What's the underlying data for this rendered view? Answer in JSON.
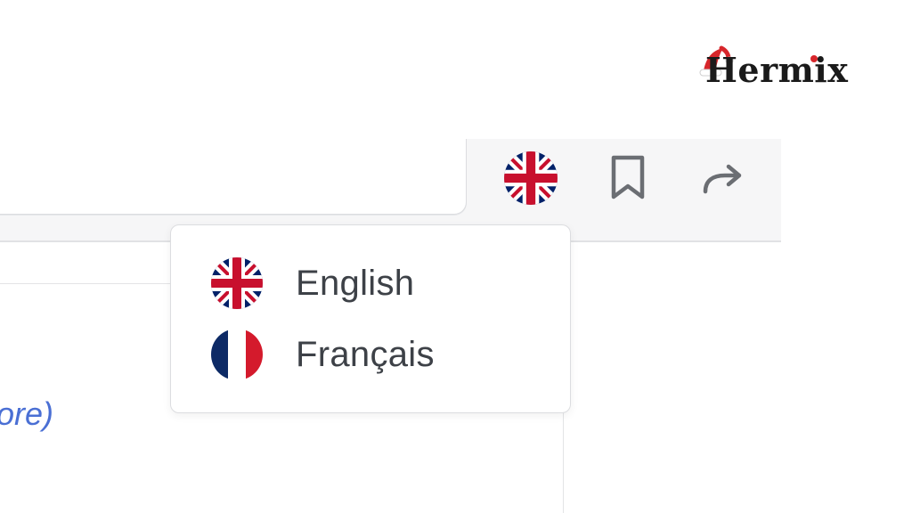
{
  "brand": {
    "name": "Hermix",
    "accent_color": "#d7262b"
  },
  "toolbar": {
    "language_button_icon": "uk-flag-icon",
    "bookmark_icon": "bookmark-icon",
    "share_icon": "share-arrow-icon"
  },
  "content": {
    "link_text": "ore)"
  },
  "language_menu": {
    "items": [
      {
        "label": "English",
        "icon": "uk-flag-icon"
      },
      {
        "label": "Français",
        "icon": "france-flag-icon"
      }
    ]
  },
  "colors": {
    "toolbar_bg": "#f6f6f7",
    "link": "#4a6fd4",
    "menu_text": "#3d4147",
    "flag_blue": "#012169",
    "flag_red": "#c8102e"
  }
}
